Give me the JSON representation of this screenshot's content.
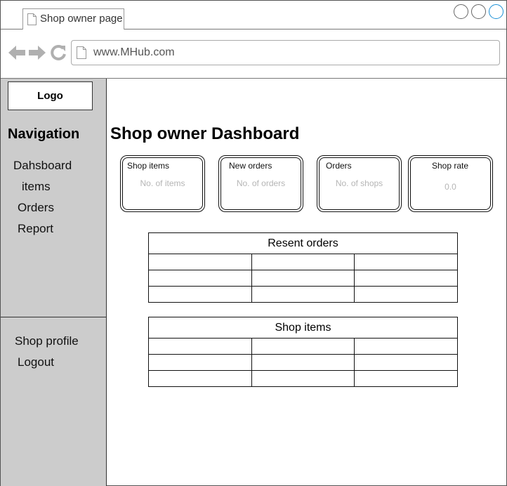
{
  "browser": {
    "tab_title": "Shop owner page",
    "url": "www.MHub.com"
  },
  "sidebar": {
    "logo": "Logo",
    "heading": "Navigation",
    "items": [
      {
        "label": "Dahsboard"
      },
      {
        "label": "items"
      },
      {
        "label": "Orders"
      },
      {
        "label": "Report"
      }
    ],
    "bottom_items": [
      {
        "label": "Shop profile"
      },
      {
        "label": "Logout"
      }
    ]
  },
  "main": {
    "title": "Shop owner Dashboard",
    "cards": [
      {
        "title": "Shop items",
        "value": "No. of items"
      },
      {
        "title": "New orders",
        "value": "No. of orders"
      },
      {
        "title": "Orders",
        "value": "No. of shops"
      },
      {
        "title": "Shop rate",
        "value": "0.0"
      }
    ],
    "recent_orders": {
      "title": "Resent orders",
      "rows": [
        [
          "",
          "",
          ""
        ],
        [
          "",
          "",
          ""
        ],
        [
          "",
          "",
          ""
        ]
      ]
    },
    "shop_items": {
      "title": "Shop items",
      "rows": [
        [
          "",
          "",
          ""
        ],
        [
          "",
          "",
          ""
        ],
        [
          "",
          "",
          ""
        ]
      ]
    }
  },
  "colors": {
    "sidebar_bg": "#cccccc",
    "placeholder_text": "#b5b5b5",
    "accent_window_button": "#1a8fd6"
  }
}
